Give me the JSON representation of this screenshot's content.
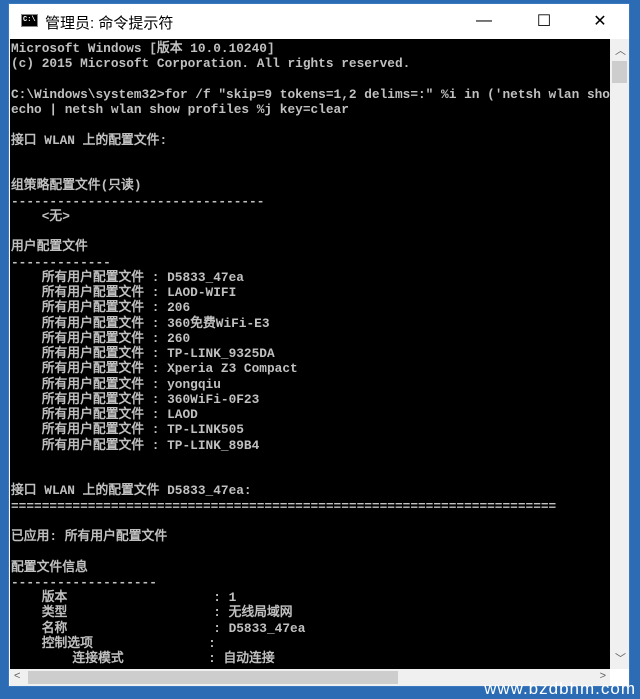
{
  "window": {
    "title": "管理员: 命令提示符",
    "icon": "cmd-icon",
    "controls": {
      "minimize": "—",
      "maximize": "☐",
      "close": "✕"
    }
  },
  "console": {
    "lines": [
      "Microsoft Windows [版本 10.0.10240]",
      "(c) 2015 Microsoft Corporation. All rights reserved.",
      "",
      "C:\\Windows\\system32>for /f \"skip=9 tokens=1,2 delims=:\" %i in ('netsh wlan sho",
      "echo | netsh wlan show profiles %j key=clear",
      "",
      "接口 WLAN 上的配置文件:",
      "",
      "",
      "组策略配置文件(只读)",
      "---------------------------------",
      "    <无>",
      "",
      "用户配置文件",
      "-------------",
      "    所有用户配置文件 : D5833_47ea",
      "    所有用户配置文件 : LAOD-WIFI",
      "    所有用户配置文件 : 206",
      "    所有用户配置文件 : 360免费WiFi-E3",
      "    所有用户配置文件 : 260",
      "    所有用户配置文件 : TP-LINK_9325DA",
      "    所有用户配置文件 : Xperia Z3 Compact",
      "    所有用户配置文件 : yongqiu",
      "    所有用户配置文件 : 360WiFi-0F23",
      "    所有用户配置文件 : LAOD",
      "    所有用户配置文件 : TP-LINK505",
      "    所有用户配置文件 : TP-LINK_89B4",
      "",
      "",
      "接口 WLAN 上的配置文件 D5833_47ea:",
      "=======================================================================",
      "",
      "已应用: 所有用户配置文件",
      "",
      "配置文件信息",
      "-------------------",
      "    版本                   : 1",
      "    类型                   : 无线局域网",
      "    名称                   : D5833_47ea",
      "    控制选项               :",
      "        连接模式           : 自动连接"
    ]
  },
  "watermark": "www.bzdbhm.com",
  "colors": {
    "console_bg": "#000000",
    "console_text": "#c0c0c0",
    "desktop": "#2b6cb4"
  }
}
